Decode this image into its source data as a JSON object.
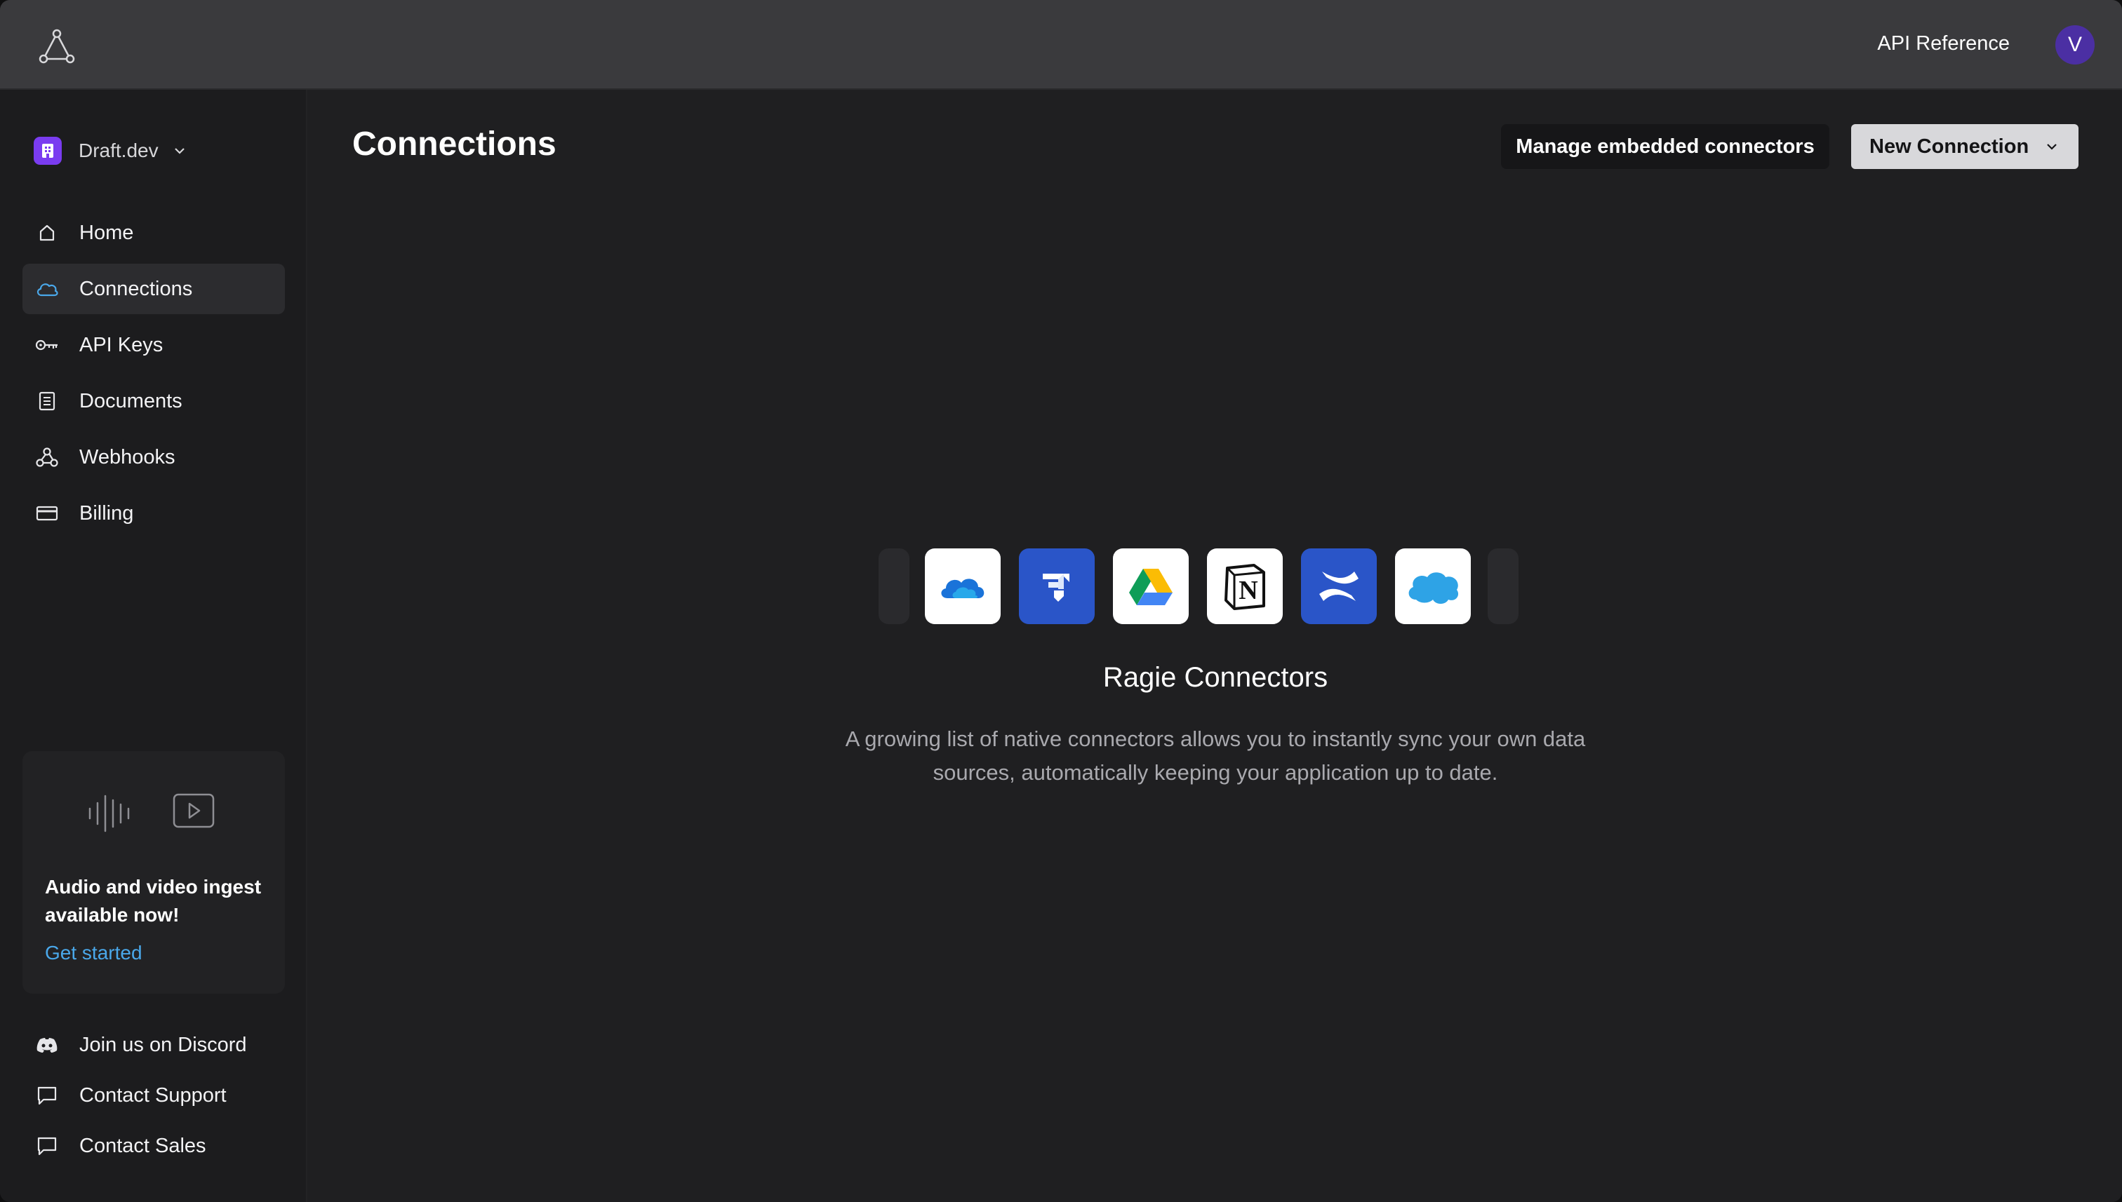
{
  "topbar": {
    "api_reference": "API Reference",
    "avatar_letter": "V",
    "avatar_color": "#4b2fa3"
  },
  "sidebar": {
    "workspace_name": "Draft.dev",
    "workspace_color": "#7a3cf0",
    "items": [
      {
        "label": "Home",
        "icon": "home-icon",
        "active": false
      },
      {
        "label": "Connections",
        "icon": "cloud-icon",
        "active": true
      },
      {
        "label": "API Keys",
        "icon": "key-icon",
        "active": false
      },
      {
        "label": "Documents",
        "icon": "document-icon",
        "active": false
      },
      {
        "label": "Webhooks",
        "icon": "webhook-icon",
        "active": false
      },
      {
        "label": "Billing",
        "icon": "credit-card-icon",
        "active": false
      }
    ],
    "promo": {
      "title": "Audio and video ingest available now!",
      "link": "Get started"
    },
    "footer": [
      {
        "label": "Join us on Discord",
        "icon": "discord-icon"
      },
      {
        "label": "Contact Support",
        "icon": "chat-icon"
      },
      {
        "label": "Contact Sales",
        "icon": "chat-icon"
      }
    ]
  },
  "main": {
    "title": "Connections",
    "manage_button": "Manage embedded connectors",
    "new_button": "New Connection",
    "connectors": [
      "onedrive-icon",
      "jira-icon",
      "google-drive-icon",
      "notion-icon",
      "confluence-icon",
      "salesforce-icon"
    ],
    "empty_title": "Ragie Connectors",
    "empty_description": "A growing list of native connectors allows you to instantly sync your own data sources, automatically keeping your application up to date."
  },
  "colors": {
    "accent_link": "#4aa8ea",
    "active_nav": "#2c2c2f",
    "background": "#1f1f21"
  }
}
